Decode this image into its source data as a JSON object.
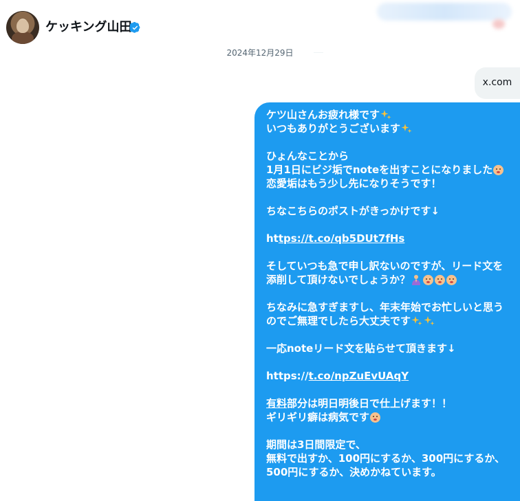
{
  "header": {
    "contact_name": "ケッキング山田",
    "verified": true
  },
  "date_separator": "2024年12月29日",
  "link_preview": {
    "text": "x.com"
  },
  "message": {
    "lines": {
      "l1": "ケツ山さんお疲れ様です",
      "l2": "いつもありがとうございます",
      "l3": "ひょんなことから",
      "l4": "1月1日にビジ垢でnoteを出すことになりました",
      "l5": "恋愛垢はもう少し先になりそうです！",
      "l6": "ちなこちらのポストがきっかけです↓",
      "l7_prefix": "ht",
      "l7_link": "tps://t.co/qb5DUt7fHs",
      "l8": "そしていつも急で申し訳ないのですが、リード文を",
      "l9": "添削して頂けないでしょうか？",
      "l10": "ちなみに急すぎますし、年末年始でお忙しいと思う",
      "l11": "のでご無理でしたら大丈夫です",
      "l12": "一応noteリード文を貼らせて頂きます↓",
      "l13_prefix": "https://",
      "l13_link": "t.co/npZuEvUAqY",
      "l14_link": "有料",
      "l14_rest": "部分は明日明後日で仕上げます！！",
      "l15": "ギリギリ癖は病気です",
      "l16": "期間は3日間限定で、",
      "l17": "無料で出すか、100円にするか、300円にするか、",
      "l18": "500円にするか、決めかねています。"
    },
    "emoji_icons": [
      "sparkles-icon",
      "pleading-face-icon",
      "praying-person-icon",
      "frowning-face-icon"
    ]
  },
  "colors": {
    "bubble": "#1d9bf0",
    "verified": "#1d9bf0",
    "link_bubble": "#eff3f4",
    "muted_text": "#536471"
  }
}
